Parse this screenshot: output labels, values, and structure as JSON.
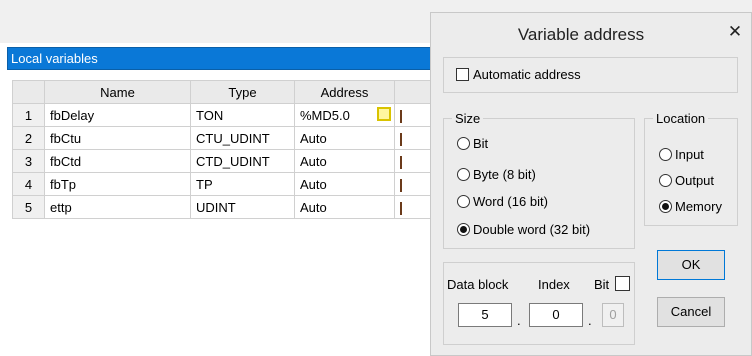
{
  "editor": {
    "panel_title": "Local variables",
    "columns": [
      "Name",
      "Type",
      "Address"
    ],
    "rows": [
      {
        "num": "1",
        "name": "fbDelay",
        "type": "TON",
        "address": "%MD5.0"
      },
      {
        "num": "2",
        "name": "fbCtu",
        "type": "CTU_UDINT",
        "address": "Auto"
      },
      {
        "num": "3",
        "name": "fbCtd",
        "type": "CTD_UDINT",
        "address": "Auto"
      },
      {
        "num": "4",
        "name": "fbTp",
        "type": "TP",
        "address": "Auto"
      },
      {
        "num": "5",
        "name": "ettp",
        "type": "UDINT",
        "address": "Auto"
      }
    ]
  },
  "dialog": {
    "title": "Variable address",
    "close_glyph": "✕",
    "automatic_address_label": "Automatic address",
    "automatic_address_checked": false,
    "size": {
      "label": "Size",
      "options": [
        "Bit",
        "Byte (8 bit)",
        "Word (16 bit)",
        "Double word (32 bit)"
      ],
      "selected": "Double word (32 bit)"
    },
    "location": {
      "label": "Location",
      "options": [
        "Input",
        "Output",
        "Memory"
      ],
      "selected": "Memory"
    },
    "data_block_label": "Data block",
    "index_label": "Index",
    "bit_label": "Bit",
    "bit_checked": false,
    "data_block_value": "5",
    "dot1": ".",
    "index_value": "0",
    "dot2": ".",
    "bit_value": "0",
    "ok_label": "OK",
    "cancel_label": "Cancel"
  },
  "colors": {
    "panel_title_bg": "#0a78d7",
    "dialog_bg": "#ececec",
    "highlight_yellow": "#fff7a0"
  }
}
